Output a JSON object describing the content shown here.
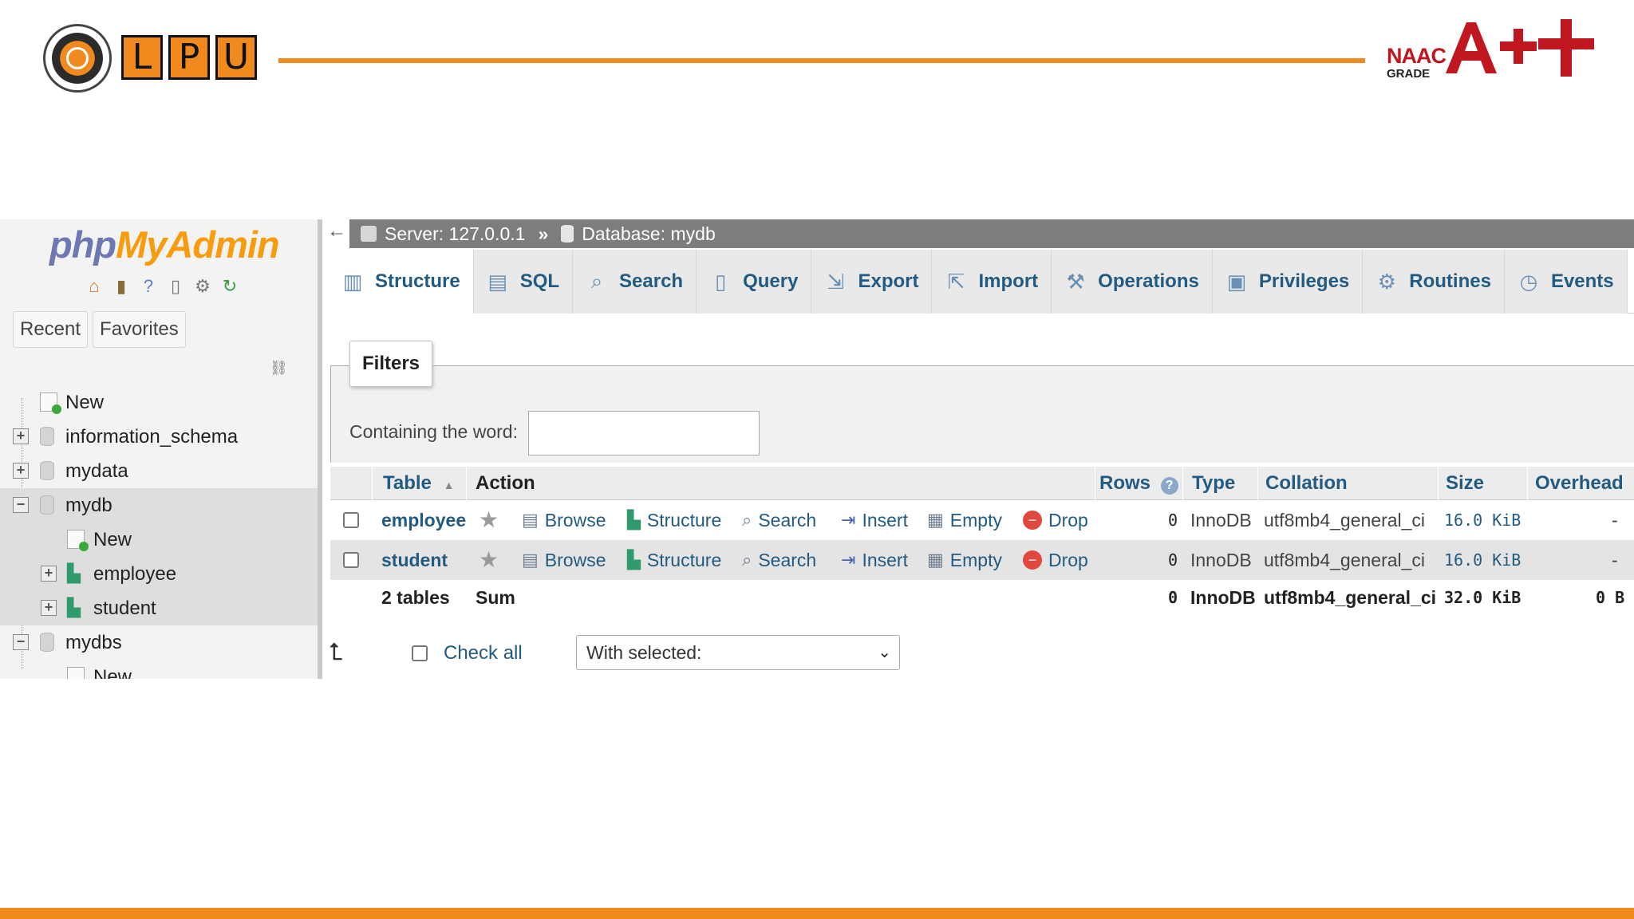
{
  "header": {
    "lpu_letters": [
      "L",
      "P",
      "U"
    ],
    "naac_label": "NAAC",
    "grade_label": "GRADE",
    "grade_value": "A++"
  },
  "sidebar": {
    "logo_php": "php",
    "logo_myadmin": "MyAdmin",
    "icons": [
      "home-icon",
      "logout-icon",
      "help-icon",
      "docs-icon",
      "settings-icon",
      "reload-icon"
    ],
    "tabs": [
      "Recent",
      "Favorites"
    ],
    "tree": [
      {
        "label": "New",
        "kind": "new",
        "level": 0
      },
      {
        "label": "information_schema",
        "kind": "db",
        "level": 0,
        "expander": "+"
      },
      {
        "label": "mydata",
        "kind": "db",
        "level": 0,
        "expander": "+"
      },
      {
        "label": "mydb",
        "kind": "db",
        "level": 0,
        "expander": "−",
        "selected": true
      },
      {
        "label": "New",
        "kind": "new",
        "level": 1,
        "selected": true
      },
      {
        "label": "employee",
        "kind": "table",
        "level": 1,
        "expander": "+",
        "selected": true
      },
      {
        "label": "student",
        "kind": "table",
        "level": 1,
        "expander": "+",
        "selected": true
      },
      {
        "label": "mydbs",
        "kind": "db",
        "level": 0,
        "expander": "−"
      },
      {
        "label": "New",
        "kind": "new",
        "level": 1
      }
    ]
  },
  "breadcrumb": {
    "server": "Server: 127.0.0.1",
    "separator": "»",
    "database": "Database: mydb"
  },
  "tabs": [
    {
      "label": "Structure",
      "icon": "structure-icon",
      "glyph": "▥",
      "active": true
    },
    {
      "label": "SQL",
      "icon": "sql-icon",
      "glyph": "▤"
    },
    {
      "label": "Search",
      "icon": "search-icon",
      "glyph": "⌕"
    },
    {
      "label": "Query",
      "icon": "query-icon",
      "glyph": "▯"
    },
    {
      "label": "Export",
      "icon": "export-icon",
      "glyph": "⇲"
    },
    {
      "label": "Import",
      "icon": "import-icon",
      "glyph": "⇱"
    },
    {
      "label": "Operations",
      "icon": "wrench-icon",
      "glyph": "⚒"
    },
    {
      "label": "Privileges",
      "icon": "privileges-icon",
      "glyph": "▣"
    },
    {
      "label": "Routines",
      "icon": "routines-icon",
      "glyph": "⚙"
    },
    {
      "label": "Events",
      "icon": "clock-icon",
      "glyph": "◷"
    }
  ],
  "filters": {
    "legend": "Filters",
    "label": "Containing the word:",
    "value": ""
  },
  "table": {
    "headers": {
      "table": "Table",
      "action": "Action",
      "rows": "Rows",
      "type": "Type",
      "collation": "Collation",
      "size": "Size",
      "overhead": "Overhead"
    },
    "actions": [
      "Browse",
      "Structure",
      "Search",
      "Insert",
      "Empty",
      "Drop"
    ],
    "rows": [
      {
        "name": "employee",
        "rows": "0",
        "type": "InnoDB",
        "collation": "utf8mb4_general_ci",
        "size": "16.0 KiB",
        "overhead": "-"
      },
      {
        "name": "student",
        "rows": "0",
        "type": "InnoDB",
        "collation": "utf8mb4_general_ci",
        "size": "16.0 KiB",
        "overhead": "-"
      }
    ],
    "summary": {
      "tables": "2 tables",
      "label": "Sum",
      "rows": "0",
      "type": "InnoDB",
      "collation": "utf8mb4_general_ci",
      "size": "32.0 KiB",
      "overhead": "0 B"
    }
  },
  "footer": {
    "check_all": "Check all",
    "with_selected": "With selected:"
  },
  "colors": {
    "accent_orange": "#f08a1e",
    "link_blue": "#235a81",
    "grade_red": "#c0161f"
  }
}
